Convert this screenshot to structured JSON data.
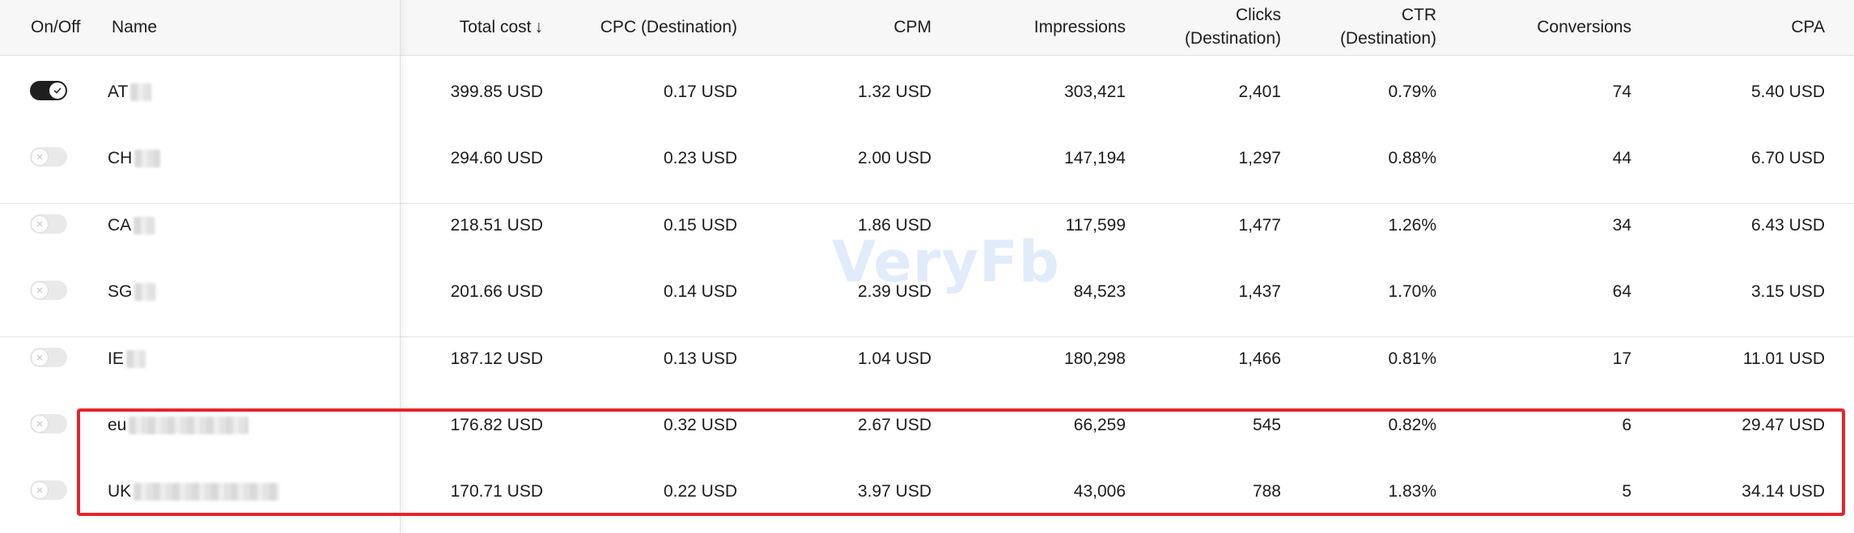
{
  "header": {
    "onoff": "On/Off",
    "name": "Name",
    "total_cost": "Total cost",
    "sort_arrow": "↓",
    "cpc": "CPC (Destination)",
    "cpm": "CPM",
    "impressions": "Impressions",
    "clicks_l1": "Clicks",
    "clicks_l2": "(Destination)",
    "ctr_l1": "CTR",
    "ctr_l2": "(Destination)",
    "conversions": "Conversions",
    "cpa": "CPA"
  },
  "rows": [
    {
      "on": true,
      "name": "AT",
      "total_cost": "399.85 USD",
      "cpc": "0.17 USD",
      "cpm": "1.32 USD",
      "impressions": "303,421",
      "clicks": "2,401",
      "ctr": "0.79%",
      "conversions": "74",
      "cpa": "5.40 USD"
    },
    {
      "on": false,
      "name": "CH",
      "total_cost": "294.60 USD",
      "cpc": "0.23 USD",
      "cpm": "2.00 USD",
      "impressions": "147,194",
      "clicks": "1,297",
      "ctr": "0.88%",
      "conversions": "44",
      "cpa": "6.70 USD"
    },
    {
      "on": false,
      "name": "CA",
      "total_cost": "218.51 USD",
      "cpc": "0.15 USD",
      "cpm": "1.86 USD",
      "impressions": "117,599",
      "clicks": "1,477",
      "ctr": "1.26%",
      "conversions": "34",
      "cpa": "6.43 USD"
    },
    {
      "on": false,
      "name": "SG",
      "total_cost": "201.66 USD",
      "cpc": "0.14 USD",
      "cpm": "2.39 USD",
      "impressions": "84,523",
      "clicks": "1,437",
      "ctr": "1.70%",
      "conversions": "64",
      "cpa": "3.15 USD"
    },
    {
      "on": false,
      "name": "IE",
      "total_cost": "187.12 USD",
      "cpc": "0.13 USD",
      "cpm": "1.04 USD",
      "impressions": "180,298",
      "clicks": "1,466",
      "ctr": "0.81%",
      "conversions": "17",
      "cpa": "11.01 USD"
    },
    {
      "on": false,
      "name": "eu",
      "total_cost": "176.82 USD",
      "cpc": "0.32 USD",
      "cpm": "2.67 USD",
      "impressions": "66,259",
      "clicks": "545",
      "ctr": "0.82%",
      "conversions": "6",
      "cpa": "29.47 USD"
    },
    {
      "on": false,
      "name": "UK",
      "total_cost": "170.71 USD",
      "cpc": "0.22 USD",
      "cpm": "3.97 USD",
      "impressions": "43,006",
      "clicks": "788",
      "ctr": "1.83%",
      "conversions": "5",
      "cpa": "34.14 USD"
    }
  ],
  "watermark": "VeryFb",
  "colors": {
    "highlight": "#e4252a",
    "toggle_on": "#1f1f1f",
    "toggle_off": "#e9e9e9",
    "header_bg": "#f7f7f7"
  }
}
